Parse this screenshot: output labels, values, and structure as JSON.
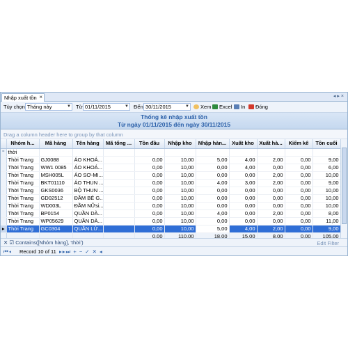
{
  "tab": {
    "title": "Nhập xuất tồn",
    "close": "×"
  },
  "toolbar": {
    "option_label": "Tùy chọn",
    "option_value": "Tháng này",
    "from_label": "Từ",
    "from_value": "01/11/2015",
    "to_label": "Đến",
    "to_value": "30/11/2015",
    "view_label": "Xem",
    "excel_label": "Excel",
    "print_label": "In",
    "close_label": "Đóng"
  },
  "report": {
    "title": "Thống kê nhập xuất tồn",
    "subtitle": "Từ ngày 01/11/2015 đến ngày 30/11/2015"
  },
  "grid": {
    "group_hint": "Drag a column header here to group by that column",
    "columns": [
      "Nhóm h...",
      "Mã hàng",
      "Tên hàng",
      "Mã tổng ...",
      "Tồn đầu",
      "Nhập kho",
      "Nhập hàn...",
      "Xuất kho",
      "Xuất hà...",
      "Kiểm kê",
      "Tồn cuối"
    ],
    "filter_value": "thời",
    "rows": [
      [
        "Thời Trang",
        "GJ0088",
        "ÁO KHOÁ...",
        "",
        "0,00",
        "10,00",
        "5,00",
        "4,00",
        "2,00",
        "0,00",
        "9,00"
      ],
      [
        "Thời Trang",
        "WW1 0085",
        "ÁO KHOÁ...",
        "",
        "0,00",
        "10,00",
        "0,00",
        "4,00",
        "0,00",
        "0,00",
        "6,00"
      ],
      [
        "Thời Trang",
        "MSH005L",
        "ÁO SƠ-MI...",
        "",
        "0,00",
        "10,00",
        "0,00",
        "0,00",
        "2,00",
        "0,00",
        "10,00"
      ],
      [
        "Thời Trang",
        "BKT01110",
        "ÁO THUN ...",
        "",
        "0,00",
        "10,00",
        "4,00",
        "3,00",
        "2,00",
        "0,00",
        "9,00"
      ],
      [
        "Thời Trang",
        "GKS0036",
        "BỘ THUN ...",
        "",
        "0,00",
        "10,00",
        "0,00",
        "0,00",
        "0,00",
        "0,00",
        "10,00"
      ],
      [
        "Thời Trang",
        "GD02512",
        "ĐẦM BÉ G...",
        "",
        "0,00",
        "10,00",
        "0,00",
        "0,00",
        "0,00",
        "0,00",
        "10,00"
      ],
      [
        "Thời Trang",
        "WD003L",
        "ĐẦM NỮsi...",
        "",
        "0,00",
        "10,00",
        "0,00",
        "0,00",
        "0,00",
        "0,00",
        "10,00"
      ],
      [
        "Thời Trang",
        "BP0154",
        "QUẦN DÀ...",
        "",
        "0,00",
        "10,00",
        "4,00",
        "0,00",
        "2,00",
        "0,00",
        "8,00"
      ],
      [
        "Thời Trang",
        "WP05629",
        "QUẦN DÀ...",
        "",
        "0,00",
        "10,00",
        "0,00",
        "0,00",
        "0,00",
        "0,00",
        "11,00"
      ],
      [
        "Thời Trang",
        "GC0304",
        "QUẦN LỬ...",
        "",
        "0,00",
        "10,00",
        "5,00",
        "4,00",
        "2,00",
        "0,00",
        "9,00"
      ]
    ],
    "selected_row": 9,
    "totals": [
      "",
      "",
      "",
      "",
      "0,00",
      "110,00",
      "18,00",
      "15,00",
      "8,00",
      "0,00",
      "105,00"
    ]
  },
  "filter": {
    "expression": "Contains([Nhóm hàng], 'thời')",
    "edit_label": "Edit Filter"
  },
  "nav": {
    "record_text": "Record 10 of 11"
  },
  "colors": {
    "accent": "#2f6ed6",
    "header_text": "#2a5fa8",
    "panel": "#dfe8f6"
  }
}
